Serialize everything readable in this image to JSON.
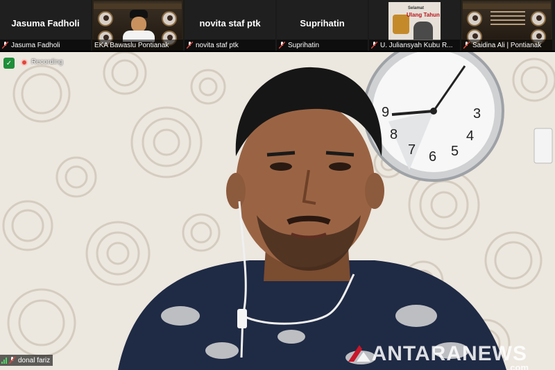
{
  "participants": [
    {
      "display": "Jasuma Fadholi",
      "label": "Jasuma Fadholi",
      "muted": true,
      "video": false
    },
    {
      "display": "",
      "label": "EKA Bawaslu Pontianak",
      "muted": true,
      "video": true
    },
    {
      "display": "novita staf ptk",
      "label": "novita staf ptk",
      "muted": true,
      "video": false
    },
    {
      "display": "Suprihatin",
      "label": "Suprihatin",
      "muted": true,
      "video": false
    },
    {
      "display": "",
      "label": "U. Juliansyah Kubu R...",
      "muted": true,
      "video": true
    },
    {
      "display": "",
      "label": "Saidina Ali | Pontianak",
      "muted": true,
      "video": true
    }
  ],
  "poster_text": {
    "bday_line1": "Selamat",
    "bday_line2": "Ulang Tahun"
  },
  "main_video": {
    "recording_label": "Recording",
    "speaker_label": "donal fariz",
    "watermark": "ANTARANEWS",
    "watermark_suffix": ".com"
  },
  "clock_numbers": [
    "9",
    "8",
    "7",
    "6",
    "5",
    "4",
    "3"
  ],
  "colors": {
    "accent_red": "#e0463a",
    "security_green": "#1f8f3a",
    "wall": "#e9e4dc",
    "strip_bg": "#1a1a1a"
  }
}
